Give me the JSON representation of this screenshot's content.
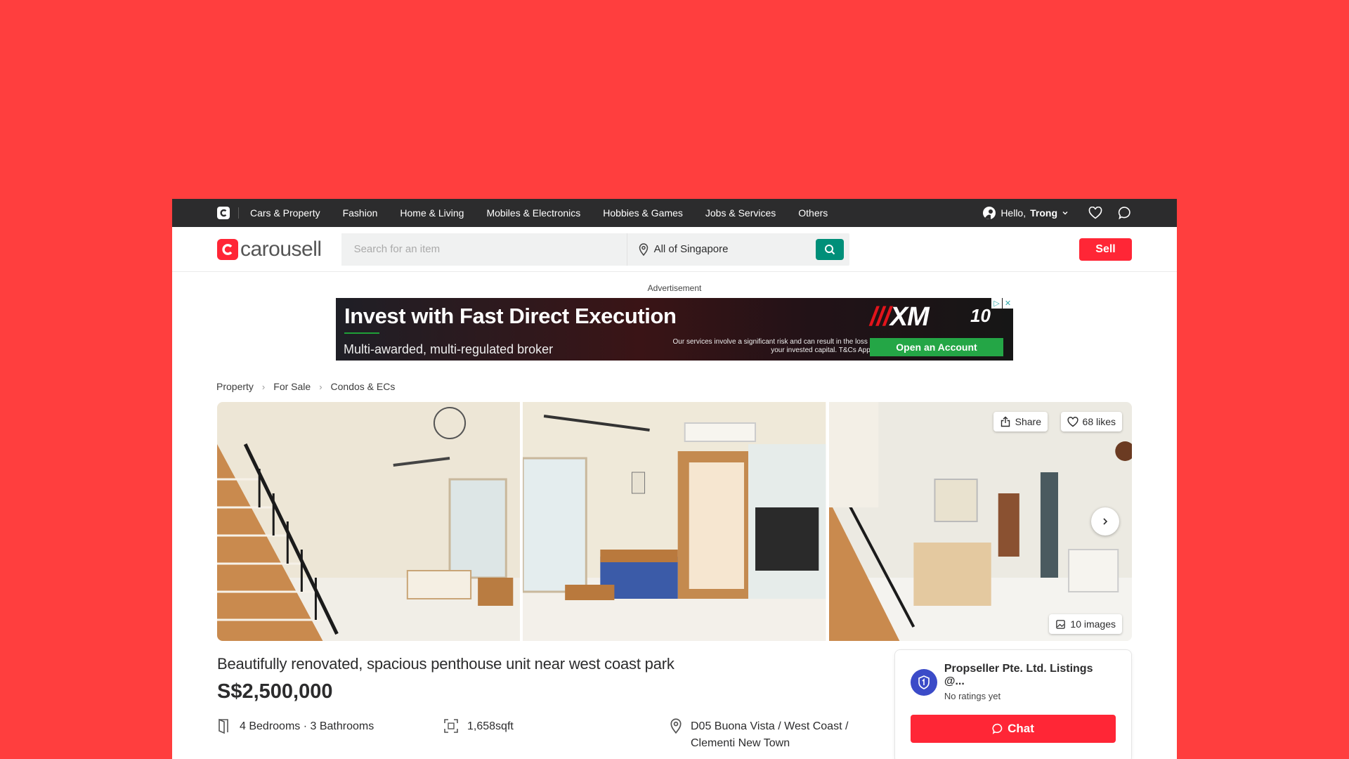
{
  "topnav": {
    "categories": [
      "Cars & Property",
      "Fashion",
      "Home & Living",
      "Mobiles & Electronics",
      "Hobbies & Games",
      "Jobs & Services",
      "Others"
    ],
    "greeting": "Hello,",
    "username": "Trong"
  },
  "header": {
    "brand": "carousell",
    "search_placeholder": "Search for an item",
    "location": "All of Singapore",
    "sell_label": "Sell"
  },
  "ad": {
    "label": "Advertisement",
    "headline": "Invest with Fast Direct Execution",
    "subline": "Multi-awarded, multi-regulated broker",
    "risk": "Our services involve a significant risk and can result in the loss of your invested capital. T&Cs Apply",
    "brand": "XM",
    "cta": "Open an Account"
  },
  "breadcrumb": [
    "Property",
    "For Sale",
    "Condos & ECs"
  ],
  "gallery": {
    "share_label": "Share",
    "likes_label": "68 likes",
    "images_label": "10 images"
  },
  "listing": {
    "title": "Beautifully renovated, spacious penthouse unit near west coast park",
    "price": "S$2,500,000",
    "bedrooms": "4 Bedrooms",
    "bathrooms": "3 Bathrooms",
    "area": "1,658sqft",
    "location_line1": "D05 Buona Vista / West Coast /",
    "location_line2": "Clementi New Town"
  },
  "seller": {
    "name": "Propseller Pte. Ltd. Listings @...",
    "rating": "No ratings yet",
    "chat_label": "Chat"
  },
  "colors": {
    "background": "#FF3E3E",
    "brand_red": "#FF2636",
    "search_green": "#008F79",
    "topnav": "#2C2C2D",
    "seller_avatar": "#3B4BC8"
  }
}
